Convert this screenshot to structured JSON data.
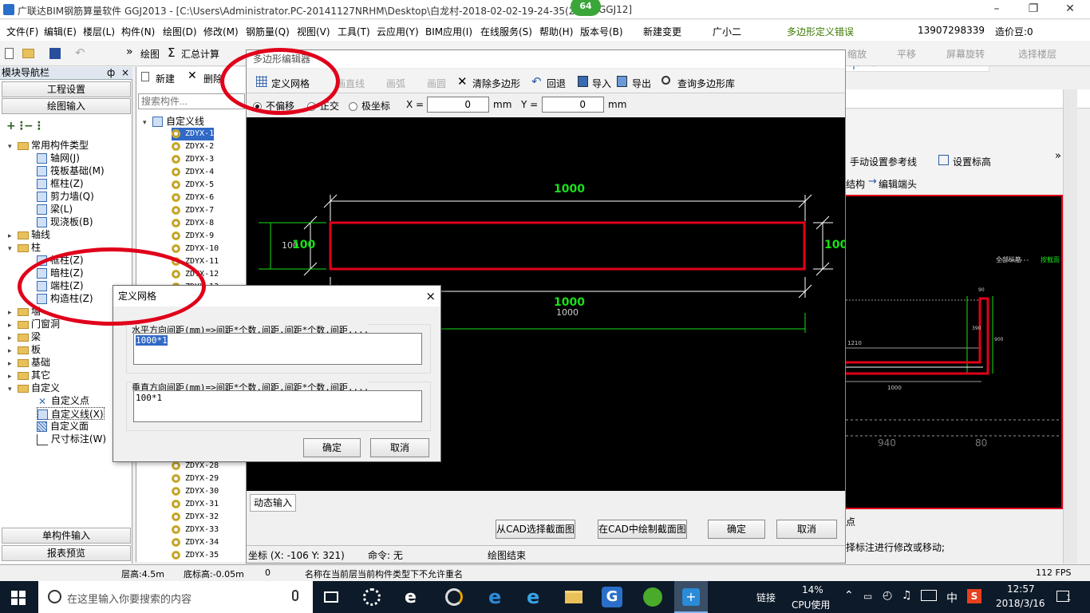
{
  "window": {
    "title": "广联达BIM钢筋算量软件 GGJ2013 - [C:\\Users\\Administrator.PC-20141127NRHM\\Desktop\\白龙村-2018-02-02-19-24-35(20",
    "title_suffix": "GGJ12]",
    "badge": "64"
  },
  "menubar": {
    "items": [
      "文件(F)",
      "编辑(E)",
      "楼层(L)",
      "构件(N)",
      "绘图(D)",
      "修改(M)",
      "钢筋量(Q)",
      "视图(V)",
      "工具(T)",
      "云应用(Y)",
      "BIM应用(I)",
      "在线服务(S)",
      "帮助(H)",
      "版本号(B)"
    ],
    "new_change": "新建变更",
    "assistant": "广小二",
    "error_tip": "多边形定义错误",
    "phone": "13907298339",
    "price": "造价豆:0"
  },
  "toolbar": {
    "draw": "绘图",
    "sum": "汇总计算",
    "right_items": [
      "缩放",
      "平移",
      "屏幕旋转",
      "选择楼层"
    ]
  },
  "left_panel": {
    "title": "模块导航栏",
    "pin": "ф",
    "close": "×",
    "btn_project": "工程设置",
    "btn_draw": "绘图输入",
    "tree": [
      "常用构件类型",
      "轴网(J)",
      "筏板基础(M)",
      "框柱(Z)",
      "剪力墙(Q)",
      "梁(L)",
      "现浇板(B)",
      "轴线",
      "柱",
      "框柱(Z)",
      "暗柱(Z)",
      "端柱(Z)",
      "构造柱(Z)",
      "墙",
      "门窗洞",
      "梁",
      "板",
      "基础",
      "其它",
      "自定义",
      "自定义点",
      "自定义线(X)",
      "自定义面",
      "尺寸标注(W)"
    ],
    "btn_single": "单构件输入",
    "btn_report": "报表预览"
  },
  "comp_panel": {
    "new": "新建",
    "delete": "删除",
    "search_placeholder": "搜索构件...",
    "root": "自定义线",
    "items_top": [
      "ZDYX-1",
      "ZDYX-2",
      "ZDYX-3",
      "ZDYX-4",
      "ZDYX-5",
      "ZDYX-6",
      "ZDYX-7",
      "ZDYX-8",
      "ZDYX-9",
      "ZDYX-10",
      "ZDYX-11",
      "ZDYX-12",
      "ZDYX-13"
    ],
    "items_bottom": [
      "ZDYX-28",
      "ZDYX-29",
      "ZDYX-30",
      "ZDYX-31",
      "ZDYX-32",
      "ZDYX-33",
      "ZDYX-34",
      "ZDYX-35"
    ]
  },
  "poly_editor": {
    "title": "多边形编辑器",
    "tools": {
      "define_grid": "定义网格",
      "line": "画直线",
      "arc": "画弧",
      "circle": "画圆",
      "clear": "清除多边形",
      "undo": "回退",
      "import": "导入",
      "export": "导出",
      "query": "查询多边形库"
    },
    "options": {
      "no_offset": "不偏移",
      "ortho": "正交",
      "polar": "极坐标",
      "x_label": "X =",
      "x_value": "0",
      "y_label": "Y =",
      "y_value": "0",
      "unit": "mm"
    },
    "dims": {
      "top": "1000",
      "left": "100",
      "left_small": "100",
      "right": "100",
      "bottom": "1000",
      "bottom_small": "1000"
    },
    "dynamic_input": "动态输入",
    "buttons": {
      "pick_cad": "从CAD选择截面图",
      "draw_cad": "在CAD中绘制截面图",
      "ok": "确定",
      "cancel": "取消"
    },
    "status": {
      "coords": "坐标 (X: -106 Y: 321)",
      "command": "命令: 无",
      "drawing_end": "绘图结束"
    }
  },
  "right_pane": {
    "manual_ref": "手动设置参考线",
    "set_elev": "设置标高",
    "structure": "结构",
    "edit_end": "编辑端头",
    "drawing_labels": {
      "longitudinal": "全部纵筋",
      "hook": "按截面",
      "d1": "1210",
      "d2": "1000",
      "d3": "940",
      "d4": "80",
      "d5": "90",
      "d6": "390",
      "d7": "900"
    },
    "hint_tail": "点",
    "bottom_hint": "择标注进行修改或移动;"
  },
  "grid_dialog": {
    "title": "定义网格",
    "close": "×",
    "h_label": "水平方向间距(mm)=>间距*个数,间距,间距*个数,间距,...",
    "h_value": "1000*1",
    "v_label": "垂直方向间距(mm)=>间距*个数,间距,间距*个数,间距,...",
    "v_value": "100*1",
    "ok": "确定",
    "cancel": "取消"
  },
  "statusbar": {
    "floor_height": "层高:4.5m",
    "base_height": "底标高:-0.05m",
    "zero": "0",
    "message": "名称在当前层当前构件类型下不允许重名",
    "fps": "112 FPS"
  },
  "taskbar": {
    "search_placeholder": "在这里输入你要搜索的内容",
    "link": "链接",
    "cpu_pct": "14%",
    "cpu_label": "CPU使用",
    "ime": "中",
    "time": "12:57",
    "date": "2018/3/16",
    "notif": "1"
  },
  "colors": {
    "accent_red": "#e0001a",
    "dim_green": "#18e018",
    "canvas_bg": "#000000",
    "task_bg": "#0d1a29"
  }
}
